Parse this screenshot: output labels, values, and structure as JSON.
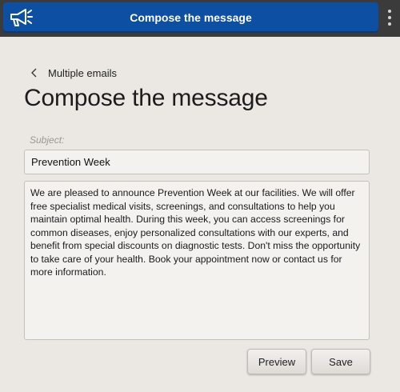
{
  "window": {
    "title": "Compose the message",
    "app_icon": "megaphone-icon",
    "menu_icon": "kebab-menu-icon",
    "accent_color": "#0d4fa3"
  },
  "breadcrumb": {
    "icon": "chevron-left-icon",
    "label": "Multiple emails"
  },
  "page": {
    "title": "Compose the message"
  },
  "form": {
    "subject_placeholder": "Subject:",
    "subject_value": "Prevention Week",
    "message_value": "We are pleased to announce Prevention Week at our facilities. We will offer free specialist medical visits, screenings, and consultations to help you maintain optimal health. During this week, you can access screenings for common diseases, enjoy personalized consultations with our experts, and benefit from special discounts on diagnostic tests. Don't miss the opportunity to take care of your health. Book your appointment now or contact us for more information."
  },
  "actions": {
    "preview_label": "Preview",
    "save_label": "Save"
  }
}
